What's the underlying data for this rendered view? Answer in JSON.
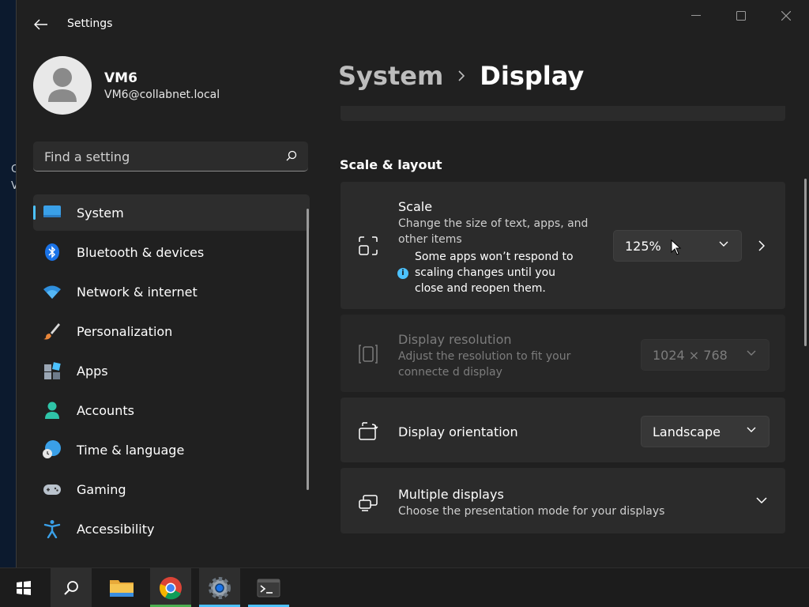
{
  "window": {
    "app_title": "Settings"
  },
  "desktop": {
    "fragments": [
      "C",
      "V"
    ]
  },
  "profile": {
    "name": "VM6",
    "email": "VM6@collabnet.local"
  },
  "search": {
    "placeholder": "Find a setting"
  },
  "nav": {
    "items": [
      {
        "label": "System",
        "icon": "system-icon",
        "selected": true
      },
      {
        "label": "Bluetooth & devices",
        "icon": "bluetooth-icon"
      },
      {
        "label": "Network & internet",
        "icon": "wifi-icon"
      },
      {
        "label": "Personalization",
        "icon": "brush-icon"
      },
      {
        "label": "Apps",
        "icon": "apps-icon"
      },
      {
        "label": "Accounts",
        "icon": "accounts-icon"
      },
      {
        "label": "Time & language",
        "icon": "globe-clock-icon"
      },
      {
        "label": "Gaming",
        "icon": "gamepad-icon"
      },
      {
        "label": "Accessibility",
        "icon": "accessibility-icon"
      }
    ]
  },
  "breadcrumb": {
    "parent": "System",
    "current": "Display"
  },
  "section": {
    "heading": "Scale & layout"
  },
  "cards": {
    "scale": {
      "title": "Scale",
      "description": "Change the size of text, apps, and other items",
      "notice": "Some apps won’t respond to scaling changes until you close and reopen them.",
      "value": "125%"
    },
    "resolution": {
      "title": "Display resolution",
      "description": "Adjust the resolution to fit your connecte d display",
      "value": "1024 × 768",
      "disabled": true
    },
    "orientation": {
      "title": "Display orientation",
      "value": "Landscape"
    },
    "multiple": {
      "title": "Multiple displays",
      "description": "Choose the presentation mode for your displays"
    }
  },
  "taskbar": {
    "items": [
      "start-icon",
      "search-icon",
      "file-explorer-icon",
      "chrome-icon",
      "settings-icon",
      "terminal-icon"
    ]
  },
  "colors": {
    "accent": "#4cc2ff",
    "window_bg": "#202020",
    "card_bg": "#2b2b2b",
    "chrome_indicator": "#4caf50"
  }
}
